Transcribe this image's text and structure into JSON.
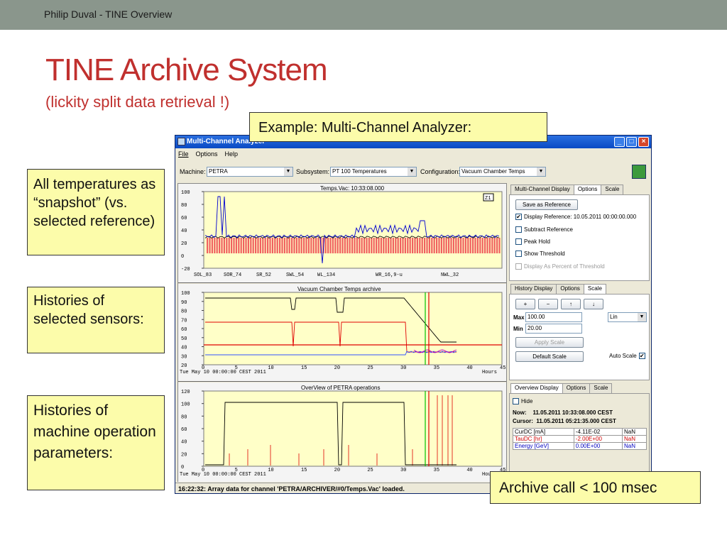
{
  "slide": {
    "header": "Philip Duval - TINE Overview",
    "title": "TINE Archive System",
    "subtitle": "(lickity split data retrieval !)"
  },
  "callouts": {
    "example": "Example: Multi-Channel Analyzer:",
    "snapshot": "All temperatures as “snapshot” (vs. selected reference)",
    "histories": "Histories of selected sensors:",
    "machine": "Histories of machine operation parameters:",
    "archive": "Archive call < 100 msec"
  },
  "window": {
    "title": "Multi-Channel Analyzer",
    "menu": [
      "File",
      "Options",
      "Help"
    ],
    "machine_label": "Machine:",
    "machine_value": "PETRA",
    "subsystem_label": "Subsystem:",
    "subsystem_value": "PT 100 Temperatures",
    "config_label": "Configuration:",
    "config_value": "Vacuum Chamber Temps",
    "status": "16:22:32: Array data for channel 'PETRA/ARCHIVER/#0/Temps.Vac' loaded."
  },
  "plots": {
    "p1": {
      "title": "Temps.Vac: 10:33:08.000",
      "yticks": [
        "100",
        "80",
        "60",
        "40",
        "20",
        "0",
        "-20"
      ],
      "xlabels": [
        "SOL_83",
        "SOR_74",
        "SR_52",
        "SWL_54",
        "WL_134",
        "WR_16,9-u",
        "NWL_32"
      ],
      "tag": "Z1"
    },
    "p2": {
      "title": "Vacuum Chamber Temps archive",
      "yticks": [
        "100",
        "90",
        "80",
        "70",
        "60",
        "50",
        "40",
        "30",
        "20"
      ],
      "xticks": [
        "0",
        "5",
        "10",
        "15",
        "20",
        "25",
        "30",
        "35",
        "40",
        "45"
      ],
      "date": "Tue May 10 00:00:00 CEST 2011",
      "unit": "Hours"
    },
    "p3": {
      "title": "OverView of PETRA operations",
      "yticks": [
        "120",
        "100",
        "80",
        "60",
        "40",
        "20",
        "0"
      ],
      "xticks": [
        "0",
        "5",
        "10",
        "15",
        "20",
        "25",
        "30",
        "35",
        "40",
        "45"
      ],
      "date": "Tue May 10 00:00:00 CEST 2011",
      "unit": "Hours"
    }
  },
  "panel1": {
    "tabs": [
      "Multi-Channel Display",
      "Options",
      "Scale"
    ],
    "save_ref": "Save as Reference",
    "display_ref": "Display Reference: 10.05.2011 00:00:00.000",
    "subtract_ref": "Subtract Reference",
    "peak_hold": "Peak Hold",
    "show_threshold": "Show Threshold",
    "display_percent": "Display As Percent of Threshold"
  },
  "panel2": {
    "tabs": [
      "History Display",
      "Options",
      "Scale"
    ],
    "buttons": [
      "+",
      "−",
      "↑",
      "↓"
    ],
    "max_label": "Max",
    "max_value": "100.00",
    "min_label": "Min",
    "min_value": "20.00",
    "scale_mode": "Lin",
    "apply": "Apply Scale",
    "default": "Default Scale",
    "auto": "Auto Scale"
  },
  "panel3": {
    "tabs": [
      "Overview Display",
      "Options",
      "Scale"
    ],
    "hide": "Hide",
    "now_label": "Now:",
    "now_value": "11.05.2011 10:33:08.000 CEST",
    "cursor_label": "Cursor:",
    "cursor_value": "11.05.2011 05:21:35.000 CEST",
    "rows": [
      {
        "name": "CurDC [mA]",
        "value": "-4.11E-02",
        "extra": "NaN",
        "color": "#000000"
      },
      {
        "name": "TauDC [hr]",
        "value": "-2.00E+00",
        "extra": "NaN",
        "color": "#d00000"
      },
      {
        "name": "Energy [GeV]",
        "value": "0.00E+00",
        "extra": "NaN",
        "color": "#0000c0"
      }
    ]
  },
  "colors": {
    "accent": "#c0302e",
    "callout": "#fcfcaa",
    "plot_bg": "#ffffc8",
    "titlebar": "#0a4ac4"
  }
}
